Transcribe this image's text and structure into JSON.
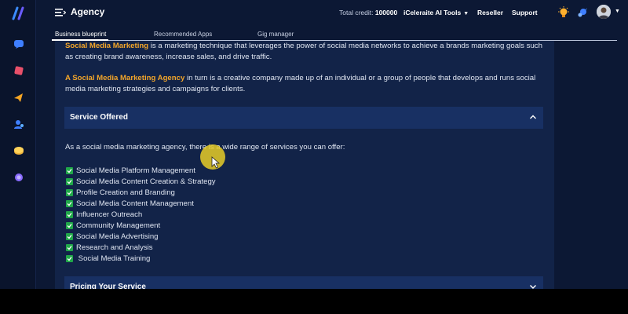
{
  "header": {
    "title": "Agency",
    "credit_label": "Total credit:",
    "credit_value": "100000",
    "tools_label": "iCeleraite AI Tools",
    "reseller_label": "Reseller",
    "support_label": "Support"
  },
  "tabs": [
    {
      "label": "Business blueprint",
      "active": true
    },
    {
      "label": "Recommended Apps",
      "active": false
    },
    {
      "label": "Gig manager",
      "active": false
    }
  ],
  "content": {
    "para1_highlight": "Social Media Marketing",
    "para1_rest": " is a marketing technique that leverages the power of social media networks to achieve a brands marketing goals such as creating brand awareness, increase sales, and drive traffic.",
    "para2_highlight": "A Social Media Marketing Agency",
    "para2_rest": " in turn is a creative company made up of an individual or a group of people that develops and runs social media marketing strategies and campaigns for clients.",
    "section1_title": "Service Offered",
    "services_intro": "As a social media marketing agency, there is a wide range of services you can offer:",
    "services": [
      "Social Media Platform Management",
      "Social Media Content Creation & Strategy",
      "Profile Creation and Branding",
      "Social Media Content Management",
      "Influencer Outreach",
      "Community Management",
      "Social Media Advertising",
      "Research and Analysis",
      " Social Media Training"
    ],
    "section2_title": "Pricing Your Service"
  },
  "colors": {
    "background": "#0c1834",
    "panel": "#122348",
    "accordion": "#183063",
    "highlight": "#f4a62a",
    "check": "#21a84a"
  },
  "icons": [
    "logo-icon",
    "chat-icon",
    "cube-icon",
    "megaphone-icon",
    "users-icon",
    "coins-icon",
    "layers-icon",
    "menu-icon",
    "bulb-icon",
    "rocket-icon",
    "chevron-up-icon",
    "chevron-down-icon",
    "check-icon"
  ]
}
